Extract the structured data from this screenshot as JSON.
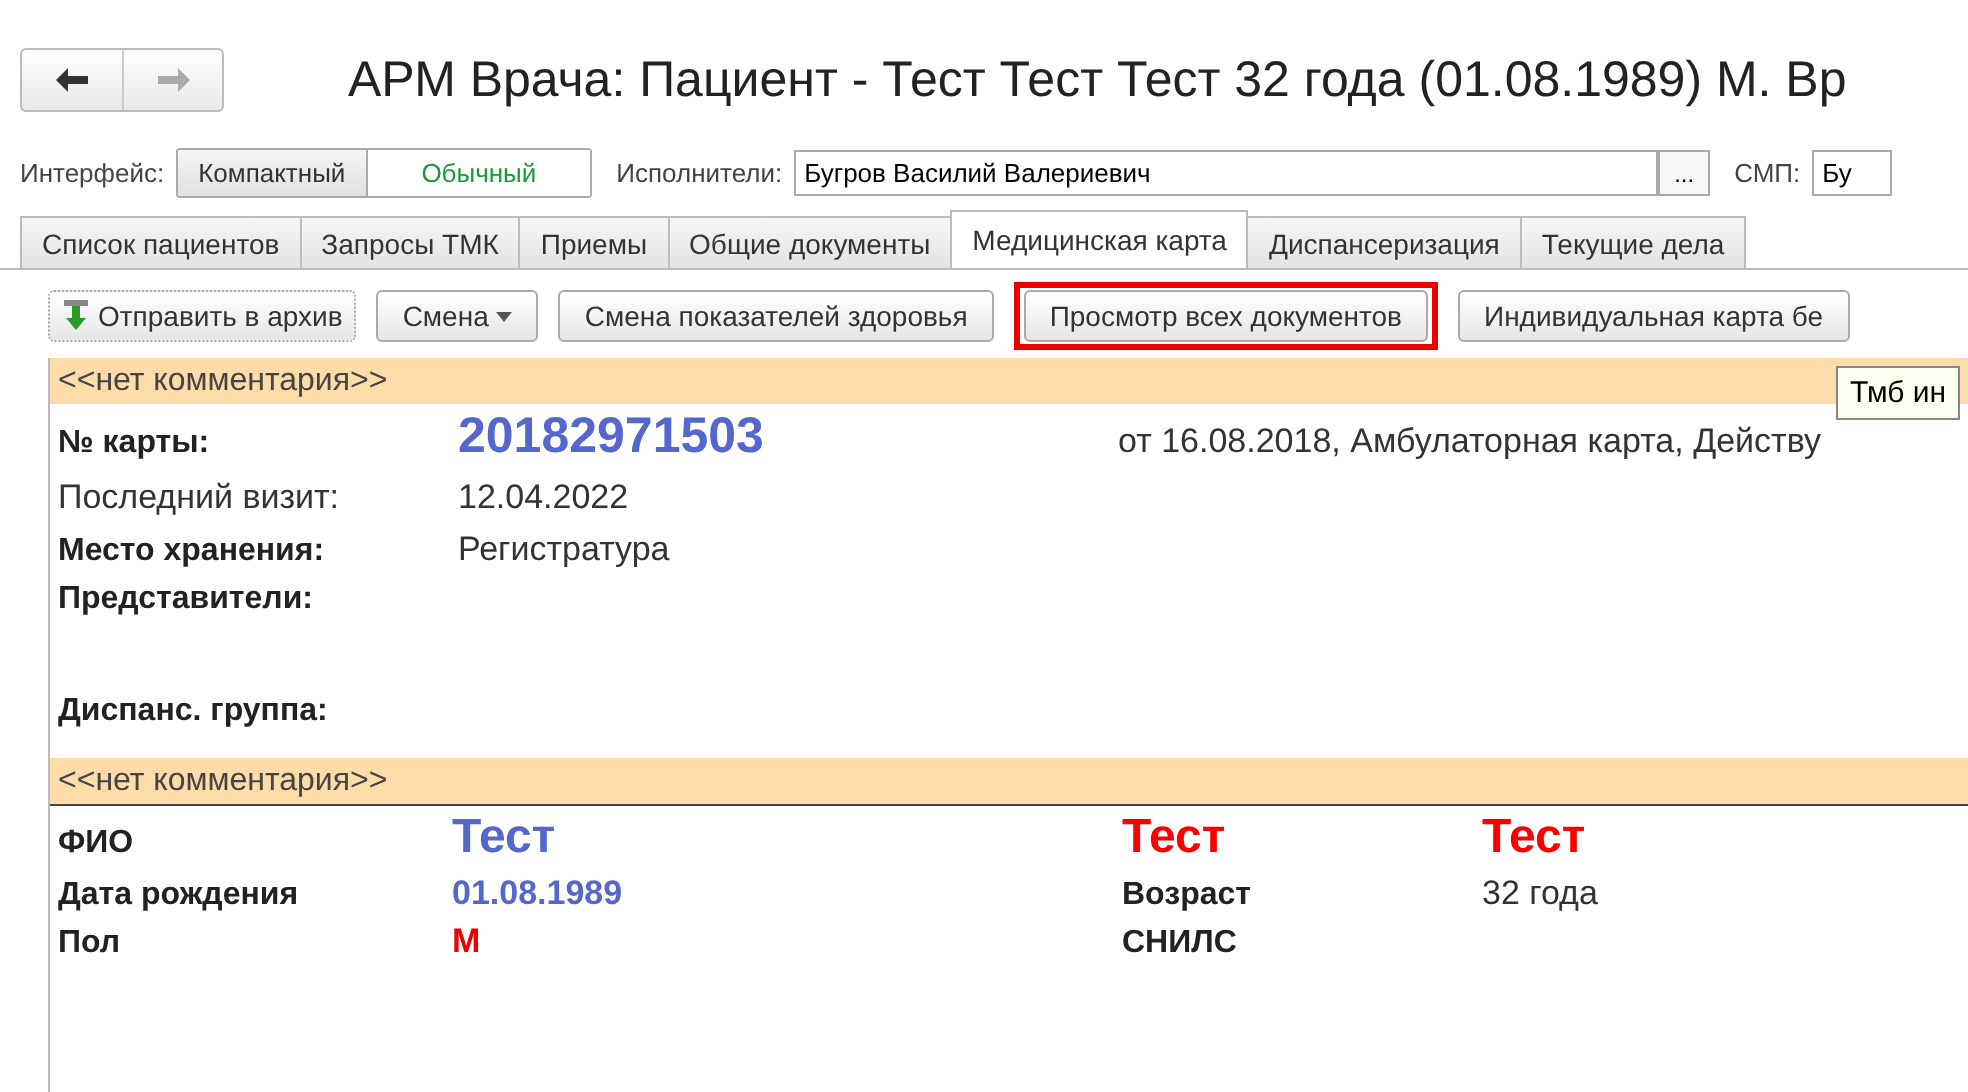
{
  "window": {
    "title": "АРМ Врача: Пациент - Тест Тест Тест 32 года  (01.08.1989) М. Вр"
  },
  "interface_switch": {
    "label": "Интерфейс:",
    "options": [
      {
        "label": "Компактный",
        "selected": false
      },
      {
        "label": "Обычный",
        "selected": true
      }
    ]
  },
  "performers": {
    "label": "Исполнители:",
    "value": "Бугров Василий Валериевич",
    "button": "..."
  },
  "smp": {
    "label": "СМП:",
    "value": "Бу"
  },
  "tabs": [
    {
      "label": "Список пациентов",
      "selected": false
    },
    {
      "label": "Запросы ТМК",
      "selected": false
    },
    {
      "label": "Приемы",
      "selected": false
    },
    {
      "label": "Общие документы",
      "selected": false
    },
    {
      "label": "Медицинская карта",
      "selected": true
    },
    {
      "label": "Диспансеризация",
      "selected": false
    },
    {
      "label": "Текущие дела",
      "selected": false
    }
  ],
  "toolbar": [
    {
      "label": "Отправить в архив",
      "kind": "archive"
    },
    {
      "label": "Смена",
      "kind": "dropdown"
    },
    {
      "label": "Смена показателей здоровья",
      "kind": "plain"
    },
    {
      "label": "Просмотр всех документов",
      "kind": "highlighted"
    },
    {
      "label": "Индивидуальная карта бе",
      "kind": "plain"
    }
  ],
  "tooltip": "Тмб ин",
  "card_section": {
    "comment": "<<нет комментария>>",
    "card_number": {
      "label": "№ карты:",
      "value": "20182971503",
      "details": "от 16.08.2018, Амбулаторная карта, Действу"
    },
    "fields": [
      {
        "label": "Последний визит:",
        "value": "12.04.2022",
        "bold": false
      },
      {
        "label": "Место хранения:",
        "value": "Регистратура",
        "bold": true
      },
      {
        "label": "Представители:",
        "bold": true
      },
      {
        "label": "Диспанс. группа:",
        "bold": true
      }
    ]
  },
  "patient_section": {
    "comment": "<<нет комментария>>",
    "fio": {
      "label": "ФИО",
      "parts": [
        {
          "text": "Тест",
          "color": "#5566cc"
        },
        {
          "text": "Тест",
          "color": "#ff0000"
        },
        {
          "text": "Тест",
          "color": "#ff0000"
        }
      ]
    },
    "birth_date": {
      "label": "Дата рождения",
      "value": "01.08.1989"
    },
    "age": {
      "label": "Возраст",
      "value": "32 года"
    },
    "sex": {
      "label": "Пол",
      "value": "М"
    },
    "snils": {
      "label": "СНИЛС"
    }
  }
}
